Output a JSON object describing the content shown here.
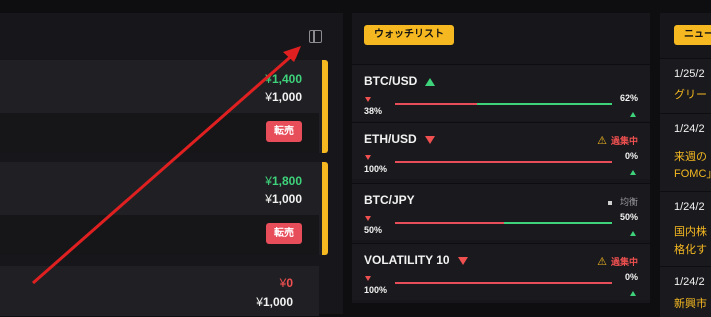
{
  "left_panel": {
    "cards": [
      {
        "price_up": "1,400",
        "price_base": "1,000",
        "sell_label": "転売"
      },
      {
        "price_up": "1,800",
        "price_base": "1,000",
        "sell_label": "転売"
      },
      {
        "price_zero": "0",
        "price_base": "1,000"
      }
    ],
    "currency_symbol": "¥"
  },
  "watchlist": {
    "tab_label": "ウォッチリスト",
    "rows": [
      {
        "pair": "BTC/USD",
        "trend": "up",
        "left_pct": "38%",
        "right_pct": "62%",
        "status": "",
        "red_fraction": 0.38
      },
      {
        "pair": "ETH/USD",
        "trend": "down",
        "left_pct": "100%",
        "right_pct": "0%",
        "status": "過集中",
        "red_fraction": 1.0
      },
      {
        "pair": "BTC/JPY",
        "trend": "",
        "left_pct": "50%",
        "right_pct": "50%",
        "status": "均衡",
        "red_fraction": 0.5
      },
      {
        "pair": "VOLATILITY 10",
        "trend": "down",
        "left_pct": "100%",
        "right_pct": "0%",
        "status": "過集中",
        "red_fraction": 1.0
      }
    ]
  },
  "news": {
    "tab_label": "ニュー",
    "items": [
      {
        "date": "1/25/2",
        "lines": [
          "グリー"
        ]
      },
      {
        "date": "1/24/2",
        "lines": [
          "来週の",
          "FOMC」"
        ]
      },
      {
        "date": "1/24/2",
        "lines": [
          "国内株",
          "格化す"
        ]
      },
      {
        "date": "1/24/2",
        "lines": [
          "新興市"
        ]
      }
    ]
  },
  "colors": {
    "accent": "#f5b820",
    "up": "#3ed37b",
    "down": "#f05050",
    "sell": "#e84d5a",
    "annotation_arrow": "#e02020"
  },
  "icons": {
    "panel_toggle": "sidebar-toggle-icon",
    "warning": "warning-triangle-icon"
  }
}
